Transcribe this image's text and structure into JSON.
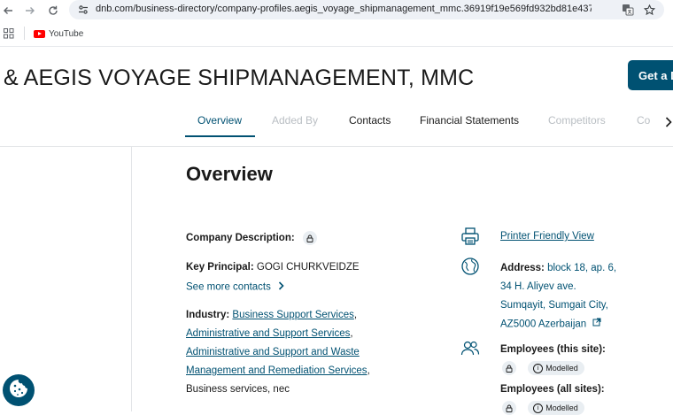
{
  "browser": {
    "url": "dnb.com/business-directory/company-profiles.aegis_voyage_shipmanagement_mmc.36919f19e569fd932bd81e4379dbb93e....",
    "bookmarks": [
      {
        "label": "YouTube"
      }
    ]
  },
  "header": {
    "company_name": "& AEGIS VOYAGE SHIPMANAGEMENT, MMC",
    "cta_label": "Get a D"
  },
  "tabs": [
    {
      "label": "Overview",
      "state": "active"
    },
    {
      "label": "Added By",
      "state": "disabled"
    },
    {
      "label": "Contacts",
      "state": "normal"
    },
    {
      "label": "Financial Statements",
      "state": "normal"
    },
    {
      "label": "Competitors",
      "state": "disabled"
    },
    {
      "label": "Co",
      "state": "disabled"
    }
  ],
  "overview": {
    "title": "Overview",
    "company_description_label": "Company Description:",
    "key_principal_label": "Key Principal:",
    "key_principal_value": "GOGI CHURKVEIDZE",
    "see_more_contacts": "See more contacts",
    "industry_label": "Industry:",
    "industries": [
      "Business Support Services",
      "Administrative and Support Services",
      "Administrative and Support and Waste",
      "Management and Remediation Services",
      "Business services, nec"
    ]
  },
  "sidebar_info": {
    "printer_friendly": "Printer Friendly View",
    "address_label": "Address:",
    "address_lines": [
      "block 18, ap. 6,",
      "34 H. Aliyev ave.",
      "Sumqayit, Sumgait City,",
      "AZ5000 Azerbaijan"
    ],
    "employees_site_label": "Employees (this site):",
    "employees_all_label": "Employees (all sites):",
    "modelled_label": "Modelled"
  },
  "colors": {
    "brand": "#005172",
    "disabled_tab": "#b9bec3",
    "chip_bg": "#e9eef2"
  }
}
